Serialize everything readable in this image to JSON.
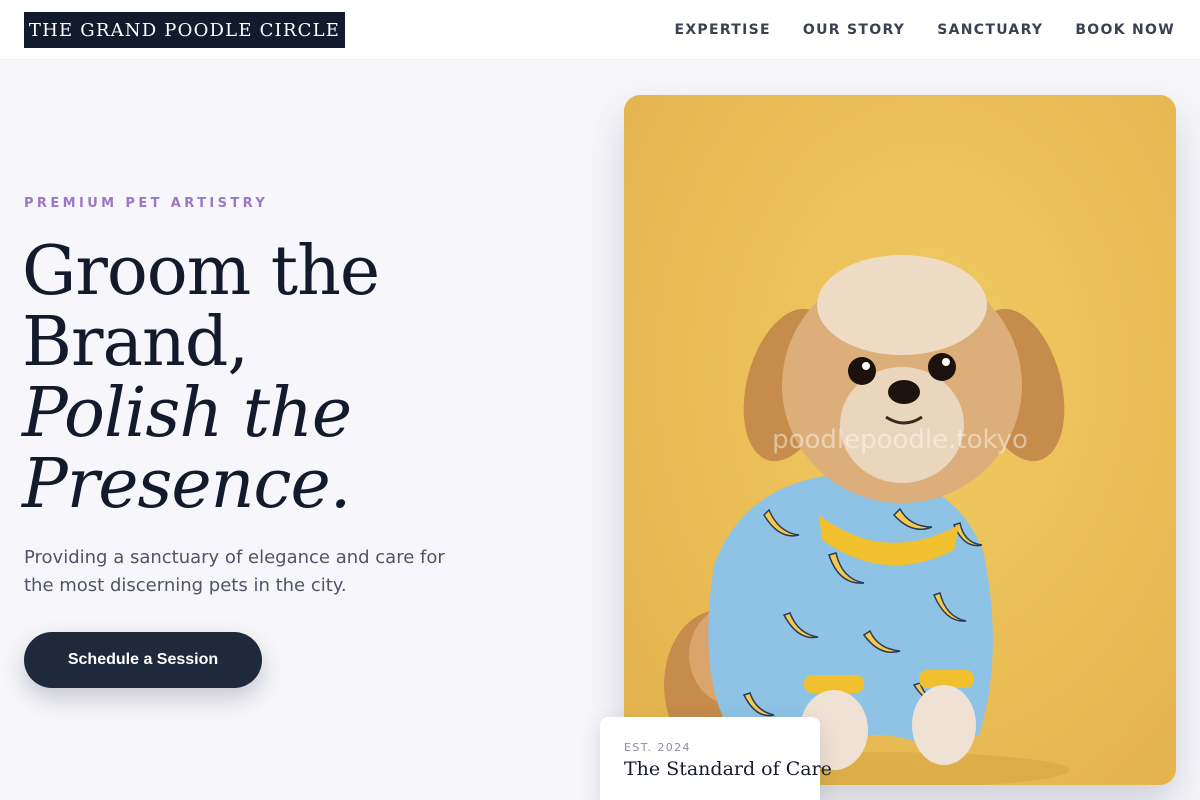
{
  "header": {
    "logo_text": "THE GRAND POODLE CIRCLE",
    "nav": [
      {
        "label": "EXPERTISE"
      },
      {
        "label": "OUR STORY"
      },
      {
        "label": "SANCTUARY"
      },
      {
        "label": "BOOK NOW"
      }
    ]
  },
  "hero": {
    "eyebrow": "PREMIUM PET ARTISTRY",
    "headline_line1": "Groom the",
    "headline_line2": "Brand,",
    "headline_line3": "Polish the",
    "headline_line4": "Presence.",
    "lede": "Providing a sanctuary of elegance and care for the most discerning pets in the city.",
    "cta_label": "Schedule a Session"
  },
  "photo": {
    "watermark": "poodlepoodle.tokyo",
    "background_color": "#ebbf57",
    "subject": "small dog in blue banana-print pajamas"
  },
  "badge": {
    "small_text": "EST. 2024",
    "title": "The Standard of Care"
  },
  "colors": {
    "brand_dark": "#121a2e",
    "accent_purple": "#9a78c4",
    "button": "#1e293b"
  }
}
